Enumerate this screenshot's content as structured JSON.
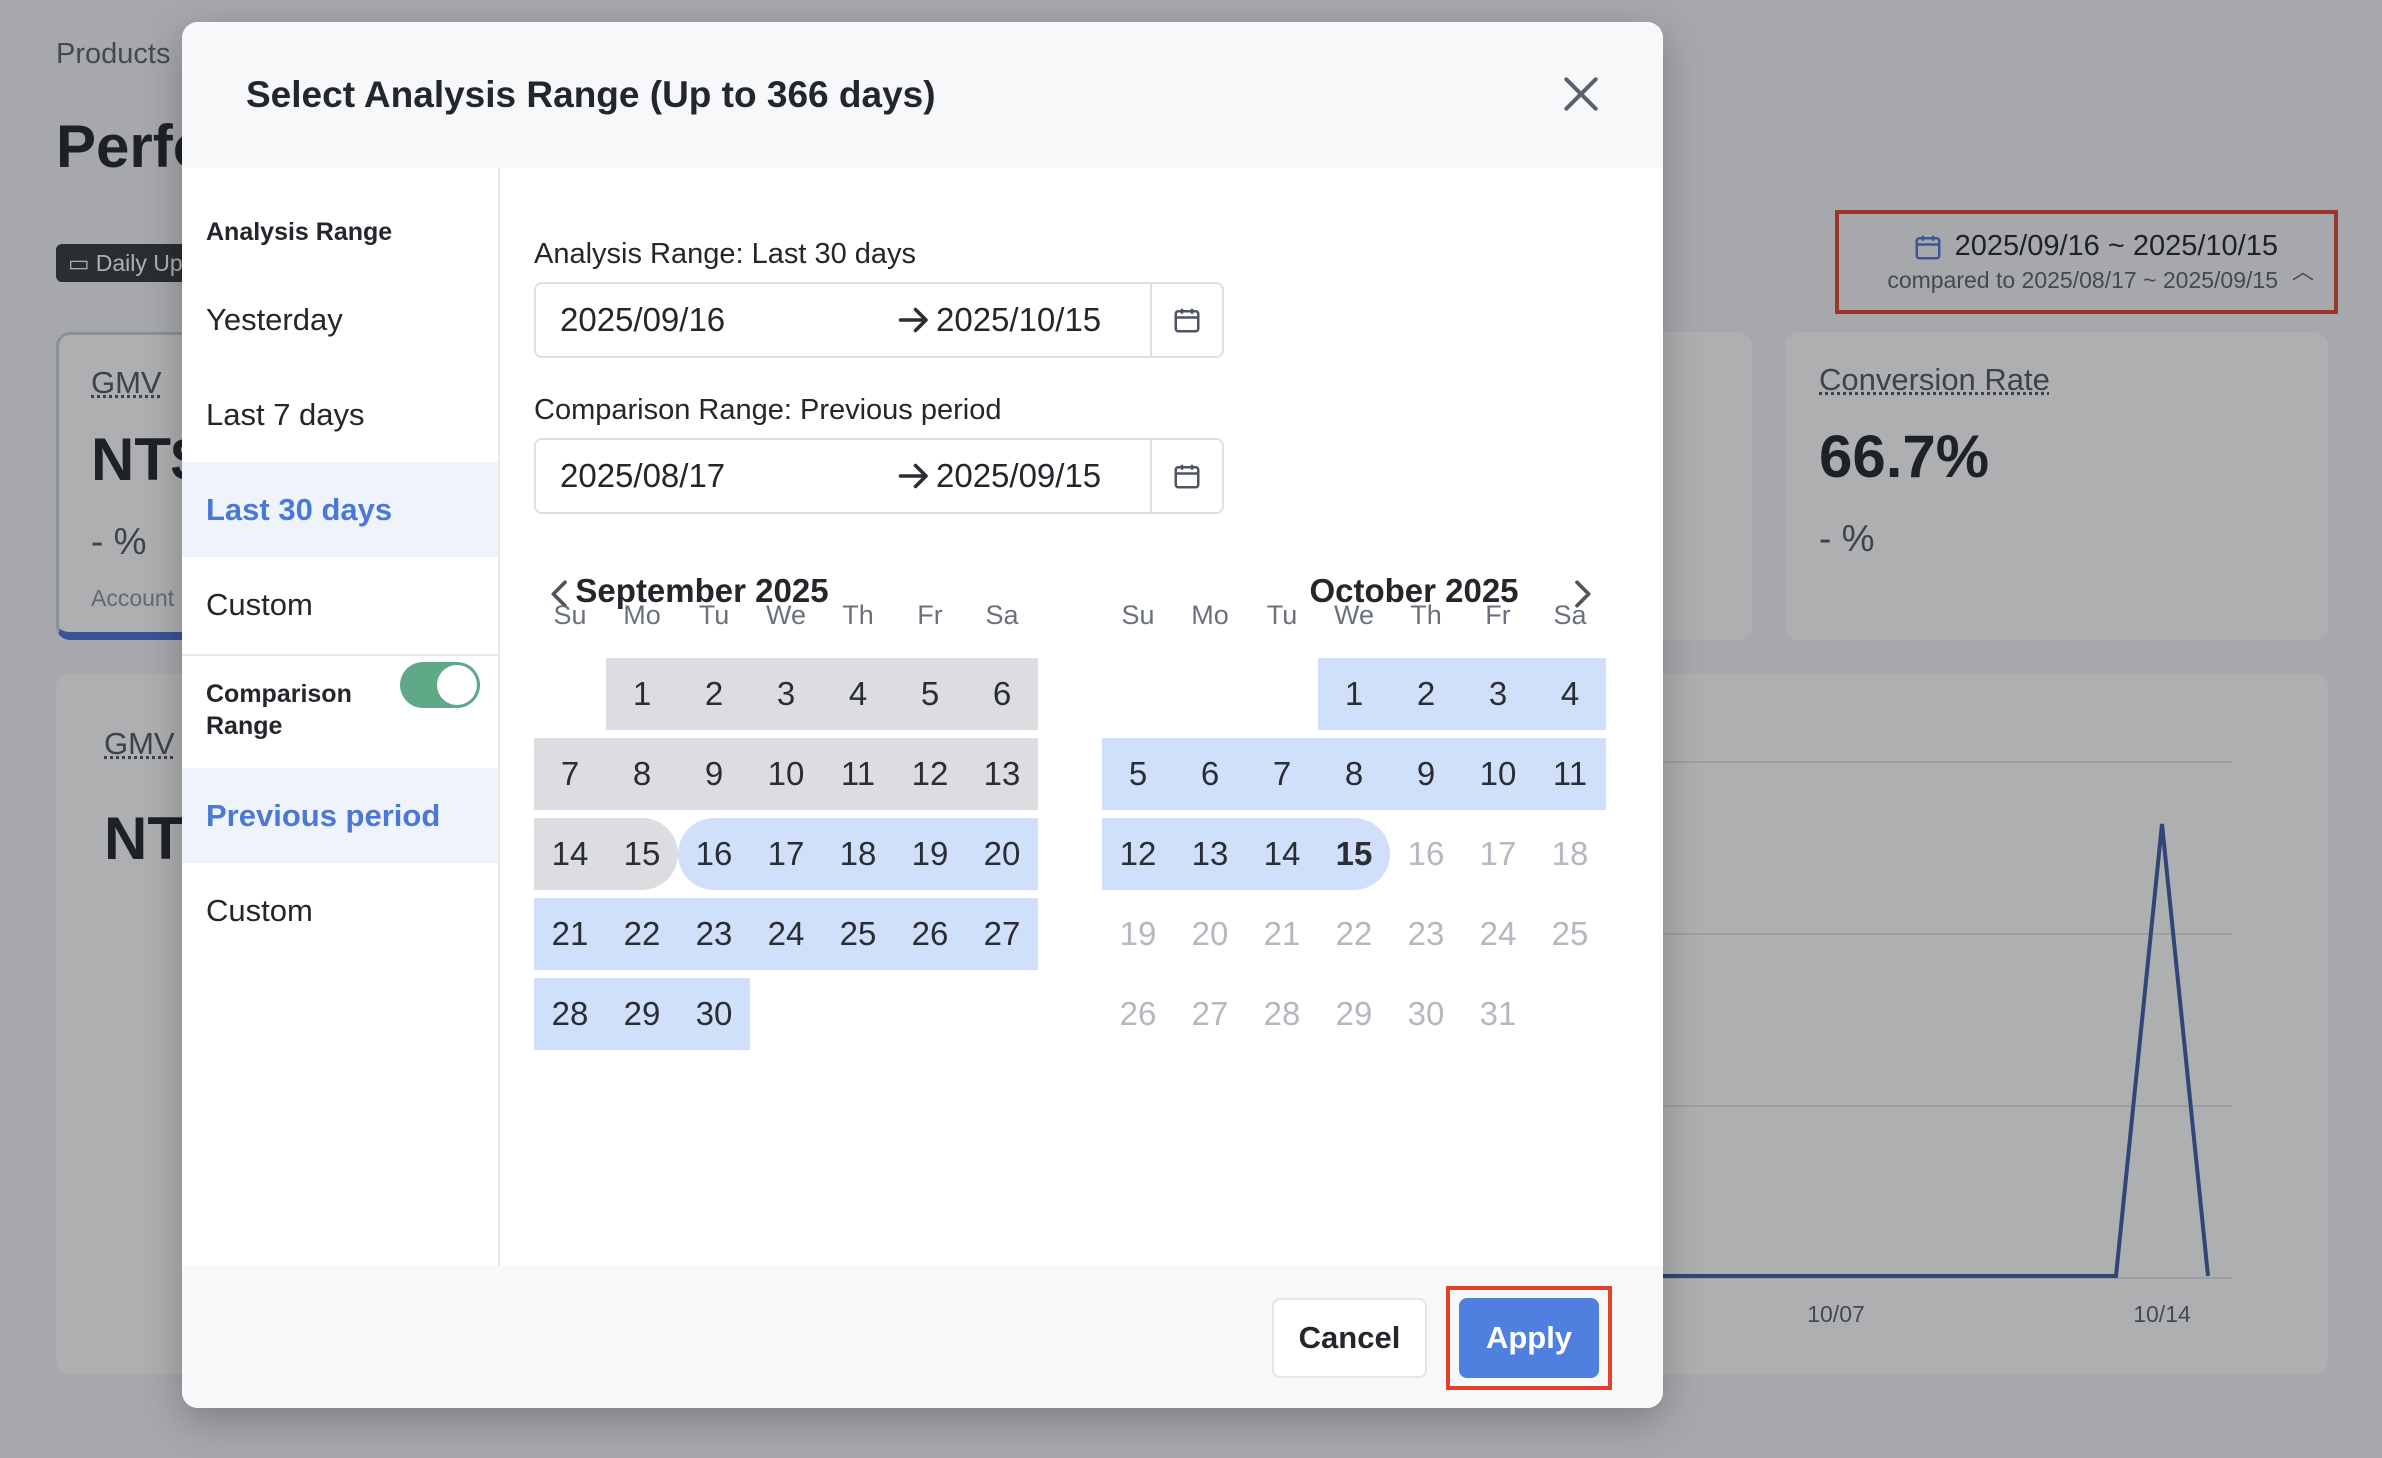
{
  "background": {
    "breadcrumb": "Products",
    "page_title": "Perfo",
    "daily_badge": "Daily Up",
    "date_picker": {
      "range": "2025/09/16 ~ 2025/10/15",
      "compare": "compared to 2025/08/17 ~ 2025/09/15"
    },
    "cards": {
      "gmv": {
        "label": "GMV",
        "value": "NT$",
        "pct": "- %",
        "foot": "Account"
      },
      "conversion": {
        "label": "Conversion Rate",
        "value": "66.7%",
        "pct": "- %"
      }
    },
    "chart": {
      "label": "GMV",
      "value": "NT",
      "x_ticks": [
        "10/07",
        "10/14"
      ]
    }
  },
  "modal": {
    "title": "Select Analysis Range (Up to 366 days)",
    "sidebar": {
      "analysis_heading": "Analysis Range",
      "analysis_items": [
        "Yesterday",
        "Last 7 days",
        "Last 30 days",
        "Custom"
      ],
      "comparison_heading": "Comparison Range",
      "comparison_items": [
        "Previous period",
        "Custom"
      ],
      "comparison_enabled": true
    },
    "analysis": {
      "label": "Analysis Range: Last 30 days",
      "start": "2025/09/16",
      "end": "2025/10/15"
    },
    "comparison": {
      "label": "Comparison Range: Previous period",
      "start": "2025/08/17",
      "end": "2025/09/15"
    },
    "weekdays": [
      "Su",
      "Mo",
      "Tu",
      "We",
      "Th",
      "Fr",
      "Sa"
    ],
    "calendars": [
      {
        "title": "September 2025",
        "first_weekday": 1,
        "days": 30
      },
      {
        "title": "October 2025",
        "first_weekday": 3,
        "days": 31
      }
    ],
    "buttons": {
      "cancel": "Cancel",
      "apply": "Apply"
    }
  },
  "colors": {
    "accent": "#4f80e0",
    "analysis_fill": "#d1e0fa",
    "comparison_fill": "#dcdde0",
    "highlight_frame": "#e0432b",
    "toggle_on": "#5fa888"
  }
}
